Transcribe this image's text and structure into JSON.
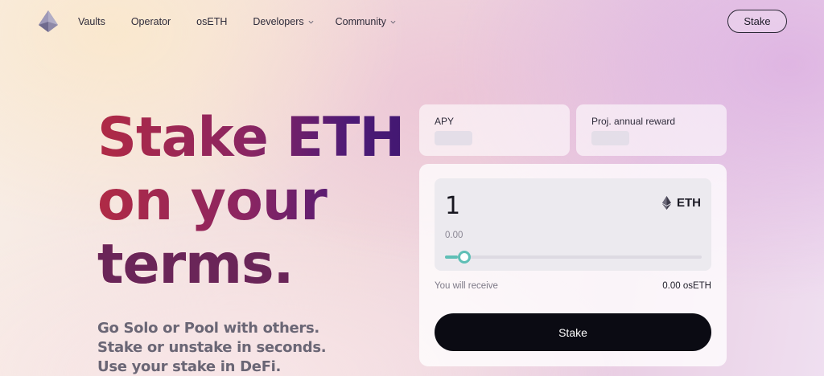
{
  "nav": {
    "links": [
      {
        "label": "Vaults",
        "has_dropdown": false
      },
      {
        "label": "Operator",
        "has_dropdown": false
      },
      {
        "label": "osETH",
        "has_dropdown": false
      },
      {
        "label": "Developers",
        "has_dropdown": true
      },
      {
        "label": "Community",
        "has_dropdown": true
      }
    ],
    "stake_label": "Stake",
    "logo_icon": "stakewise-logo-icon"
  },
  "hero": {
    "title_part1": "Stake ",
    "title_part2": "ETH",
    "title_line2": "on your",
    "title_line3": "terms.",
    "subtitle_lines": [
      "Go Solo or Pool with others.",
      "Stake or unstake in seconds.",
      "Use your stake in DeFi."
    ]
  },
  "stats": {
    "apy_label": "APY",
    "reward_label": "Proj. annual reward"
  },
  "stake_form": {
    "amount": "1",
    "token": "ETH",
    "token_icon": "eth-icon",
    "usd_value": "0.00",
    "slider_fraction": 0.05,
    "receive_label": "You will receive",
    "receive_value": "0.00 osETH",
    "button_label": "Stake"
  },
  "colors": {
    "accent_teal": "#5fbfb6",
    "button_dark": "#0b0b13",
    "title_red": "#b02a45",
    "title_purple": "#3c1770"
  }
}
